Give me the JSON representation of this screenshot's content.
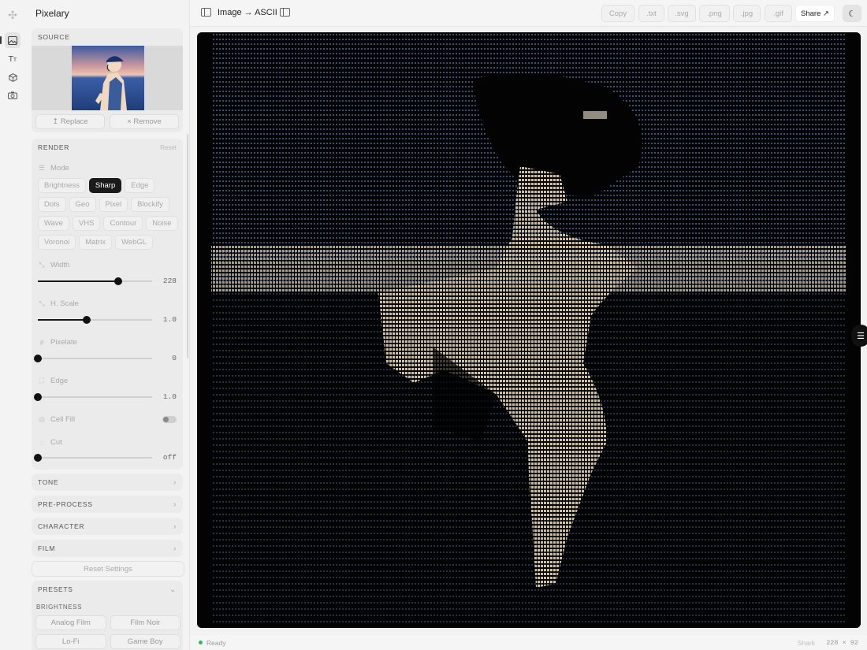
{
  "app": {
    "title": "Pixelary"
  },
  "rail": {
    "icons": [
      "image-icon",
      "text-icon",
      "cube-icon",
      "camera-icon"
    ]
  },
  "source": {
    "heading": "SOURCE",
    "replace_label": "↥ Replace",
    "remove_label": "× Remove"
  },
  "render": {
    "heading": "RENDER",
    "reset_label": "Reset",
    "mode_label": "Mode",
    "modes": [
      [
        "Brightness",
        "Sharp",
        "Edge"
      ],
      [
        "Dots",
        "Geo",
        "Pixel",
        "Blockify"
      ],
      [
        "Wave",
        "VHS",
        "Contour",
        "Noise"
      ],
      [
        "Voronoi",
        "Matrix",
        "WebGL"
      ]
    ],
    "active_mode": "Sharp",
    "width": {
      "label": "Width",
      "value": "228",
      "fraction": 0.7
    },
    "hscale": {
      "label": "H. Scale",
      "value": "1.0",
      "fraction": 0.43
    },
    "pixelate": {
      "label": "Pixelate",
      "value": "0",
      "fraction": 0.0
    },
    "edge": {
      "label": "Edge",
      "value": "1.0",
      "fraction": 0.0
    },
    "cell_fill": {
      "label": "Cell Fill",
      "on": false
    },
    "cut": {
      "label": "Cut",
      "value": "off",
      "fraction": 0.0
    }
  },
  "sections": {
    "tone": "TONE",
    "preprocess": "PRE-PROCESS",
    "character": "CHARACTER",
    "film": "FILM"
  },
  "reset_settings": "Reset Settings",
  "presets": {
    "heading": "PRESETS",
    "subheading": "BRIGHTNESS",
    "items": [
      "Analog Film",
      "Film Noir",
      "Lo-Fi",
      "Game Boy"
    ]
  },
  "toolbar": {
    "title": "Image → ASCII",
    "copy": "Copy",
    "txt": ".txt",
    "svg": ".svg",
    "png": ".png",
    "jpg": ".jpg",
    "gif": ".gif",
    "share": "Share ↗"
  },
  "status": {
    "ready": "Ready",
    "right_label": "Shark",
    "dims": "228 × 92"
  },
  "colors": {
    "canvas_bg": "#030303",
    "ascii_light": "#c9bfae",
    "ascii_blue": "#5d7fb0",
    "accent": "#1a1a1a",
    "ready_dot": "#2fb86b"
  }
}
